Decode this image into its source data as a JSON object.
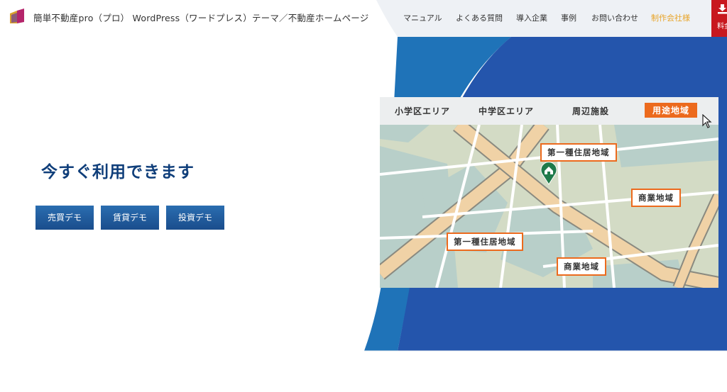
{
  "header": {
    "site_title": "簡単不動産pro（プロ） WordPress（ワードプレス）テーマ／不動産ホームページ",
    "nav": [
      {
        "label": "マニュアル"
      },
      {
        "label": "よくある質問"
      },
      {
        "label": "導入企業"
      },
      {
        "label": "事例"
      },
      {
        "label": "お問い合わせ"
      },
      {
        "label": "制作会社様"
      }
    ],
    "download_label": "料金",
    "colors": {
      "accent": "#e8a52a",
      "download_bg": "#c8181f"
    }
  },
  "hero": {
    "title": "今すぐ利用できます",
    "buttons": [
      {
        "label": "売買デモ"
      },
      {
        "label": "賃貸デモ"
      },
      {
        "label": "投資デモ"
      }
    ]
  },
  "map": {
    "tabs": [
      {
        "label": "小学区エリア"
      },
      {
        "label": "中学区エリア"
      },
      {
        "label": "周辺施設"
      },
      {
        "label": "用途地域",
        "active": true
      }
    ],
    "zones": [
      {
        "label": "第一種住居地域"
      },
      {
        "label": "商業地域"
      },
      {
        "label": "第一種住居地域"
      },
      {
        "label": "商業地域"
      }
    ],
    "colors": {
      "active_tab": "#ec6a1d",
      "road": "#f0d2a6",
      "block": "#b8cfc9",
      "land": "#d3dbc5"
    }
  },
  "colors": {
    "primary_blue": "#1a4d8c",
    "bg_blue": "#2455ac",
    "title_blue": "#0f3e7a"
  }
}
